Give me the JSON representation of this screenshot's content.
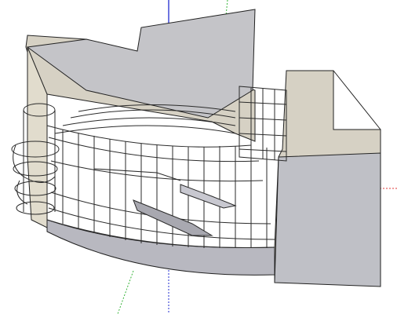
{
  "viewport": {
    "background": "#ffffff",
    "colors": {
      "wall_light": "#d6d1c4",
      "wall_shadow": "#a8a8b0",
      "roof": "#c4c4c8",
      "glass_frame": "#2a2a2a",
      "axis_blue": "#1f2bd0",
      "axis_green": "#37b43a",
      "axis_red": "#e23a3a"
    },
    "icons": {
      "axes": "3d-axes-icon",
      "model": "building-model-icon"
    }
  }
}
